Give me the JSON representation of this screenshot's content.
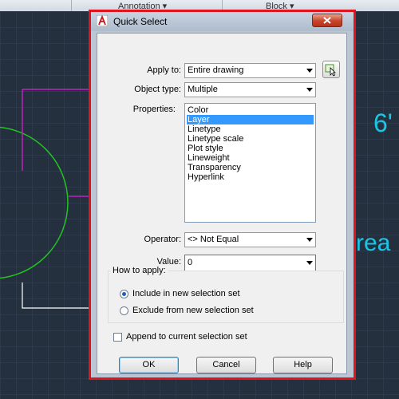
{
  "ribbon": {
    "panels": [
      "Annotation",
      "Block"
    ]
  },
  "canvas": {
    "label_top": "6'",
    "label_right": "rea"
  },
  "dialog": {
    "title": "Quick Select",
    "apply_to": {
      "label": "Apply to:",
      "value": "Entire drawing"
    },
    "object_type": {
      "label": "Object type:",
      "value": "Multiple"
    },
    "properties": {
      "label": "Properties:",
      "items": [
        "Color",
        "Layer",
        "Linetype",
        "Linetype scale",
        "Plot style",
        "Lineweight",
        "Transparency",
        "Hyperlink"
      ],
      "selected": "Layer"
    },
    "operator": {
      "label": "Operator:",
      "value": "<> Not Equal"
    },
    "value": {
      "label": "Value:",
      "value": "0"
    },
    "how_to_apply": {
      "title": "How to apply:",
      "include": "Include in new selection set",
      "exclude": "Exclude from new selection set",
      "selected": "include"
    },
    "append": {
      "label": "Append to current selection set",
      "checked": false
    },
    "buttons": {
      "ok": "OK",
      "cancel": "Cancel",
      "help": "Help"
    }
  },
  "colors": {
    "highlight": "#e0141e",
    "cad_text": "#19c6e6",
    "circle": "#22c322",
    "rect": "#c11fc1",
    "selection": "#3399ff"
  }
}
